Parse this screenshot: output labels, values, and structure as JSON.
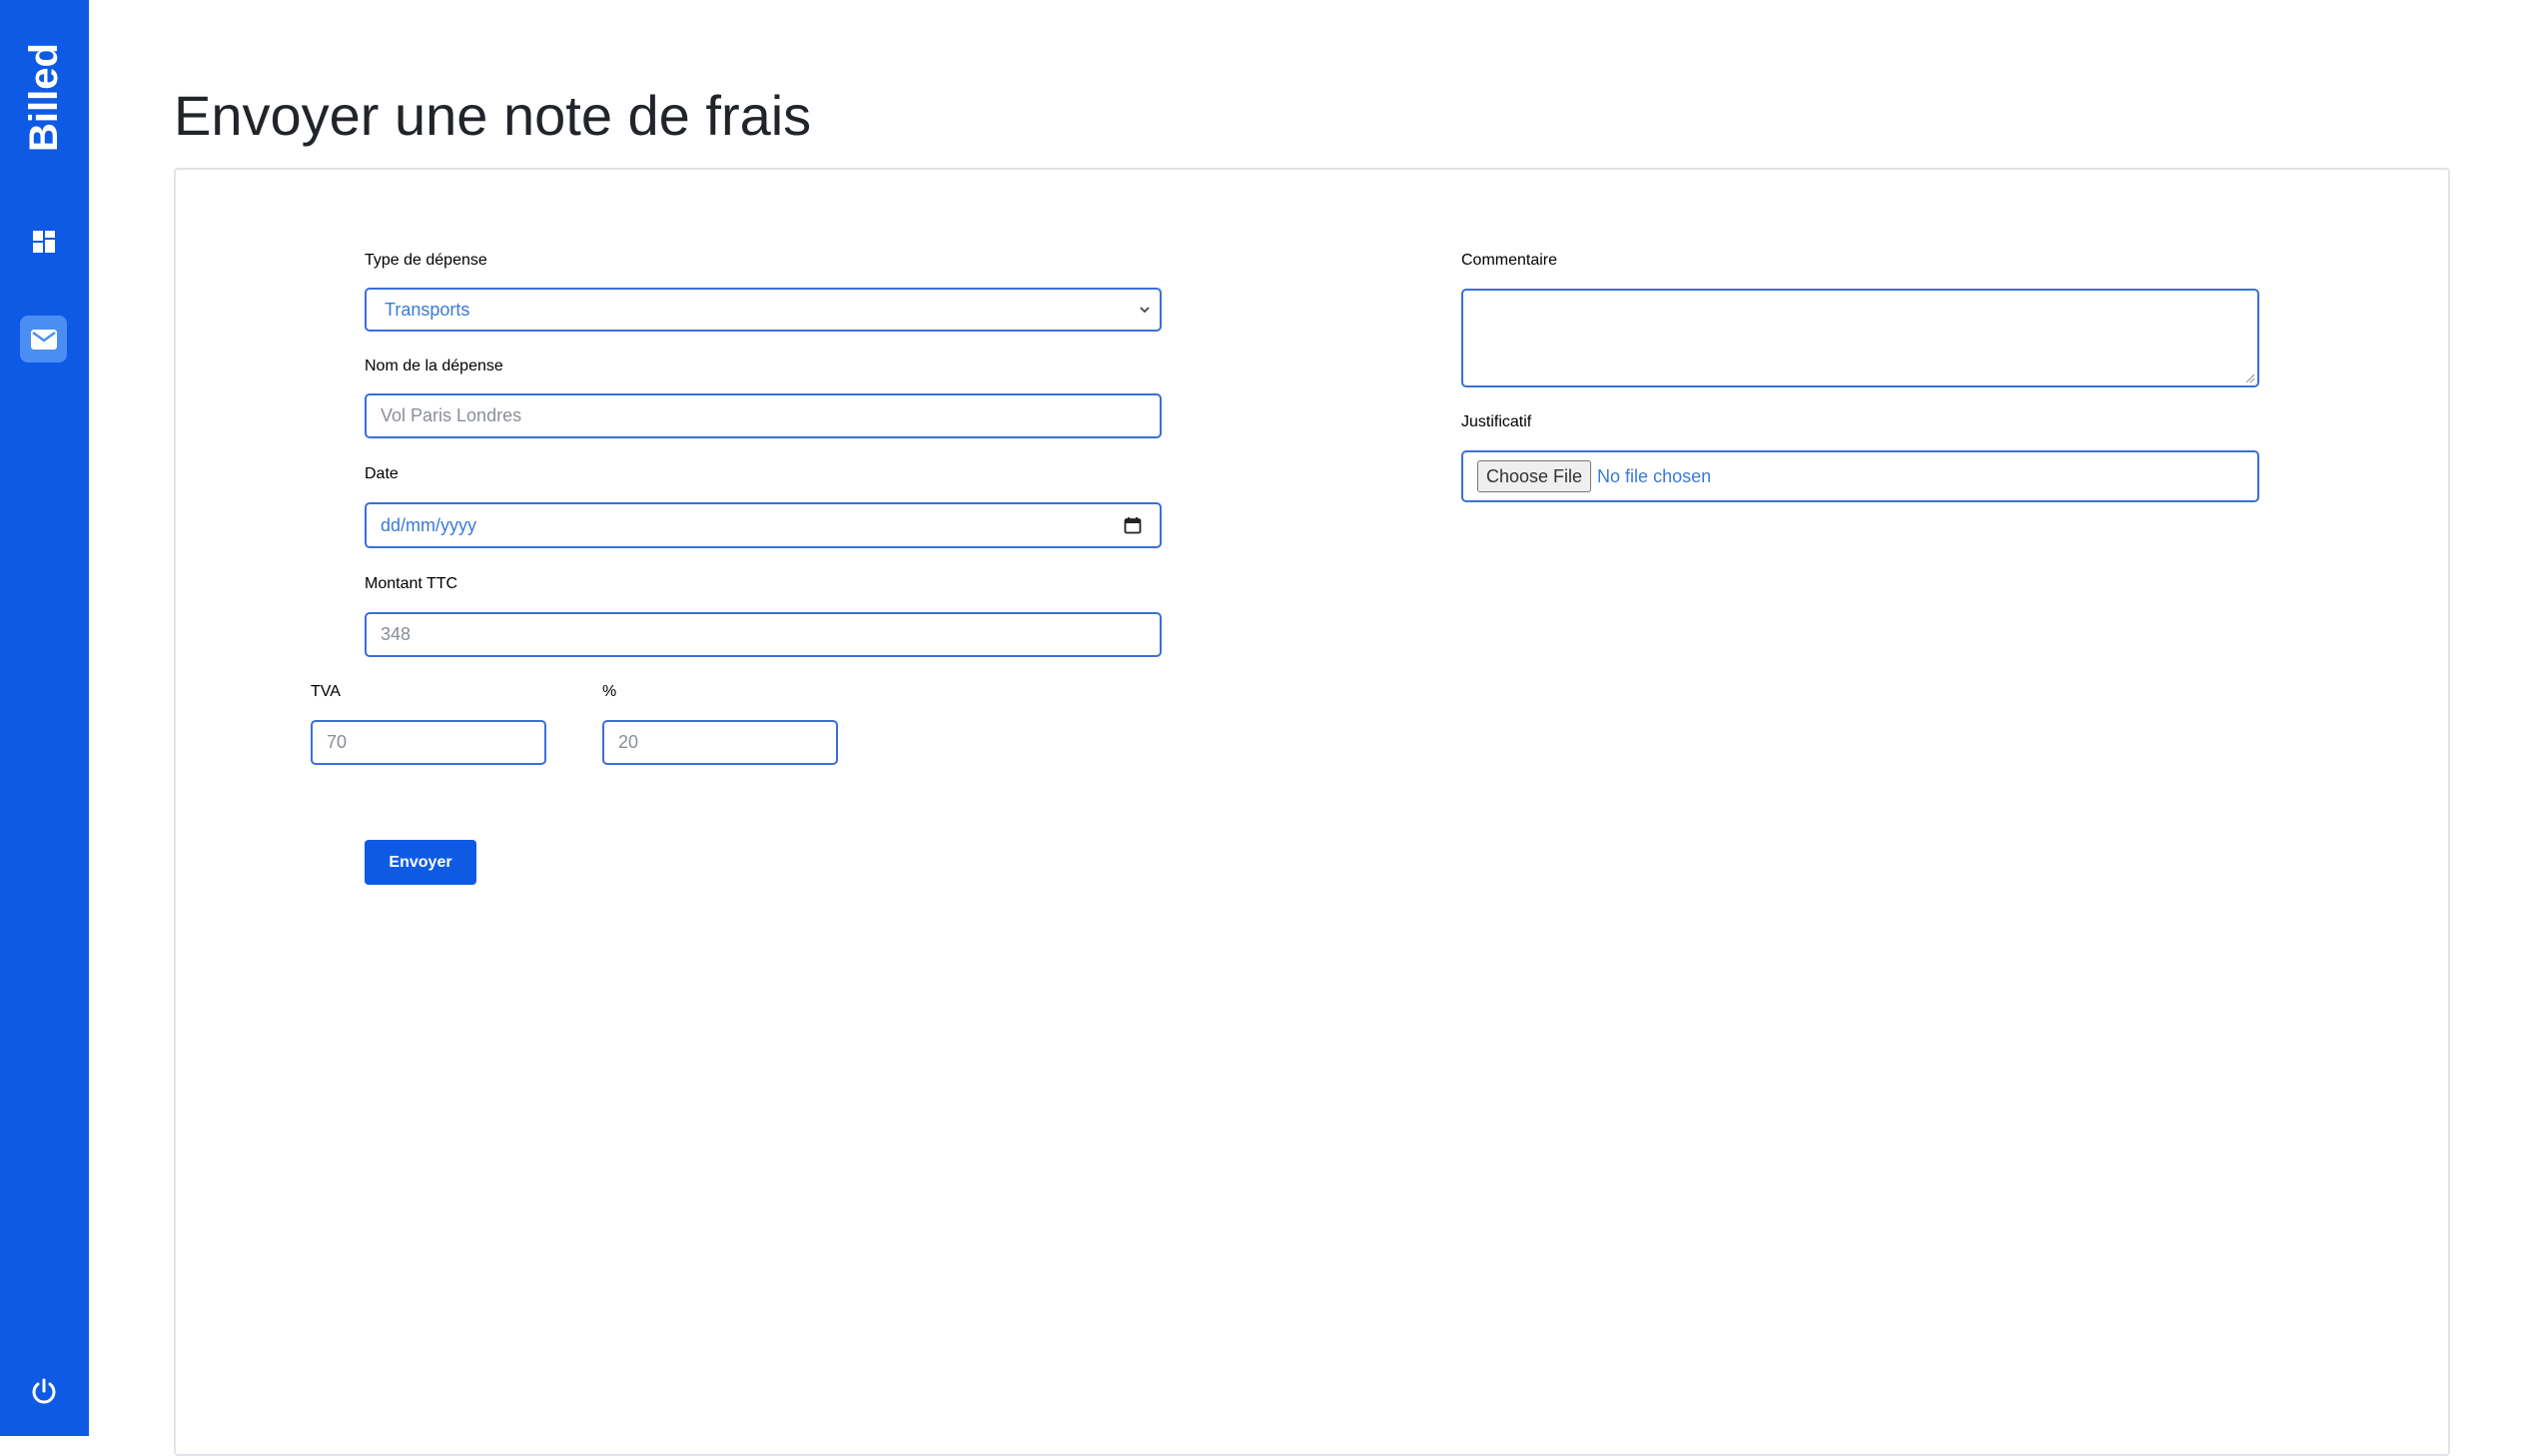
{
  "app": {
    "brand": "Billed"
  },
  "page": {
    "title": "Envoyer une note de frais"
  },
  "form": {
    "type_label": "Type de dépense",
    "type_value": "Transports",
    "name_label": "Nom de la dépense",
    "name_placeholder": "Vol Paris Londres",
    "date_label": "Date",
    "date_placeholder": "dd/mm/yyyy",
    "amount_label": "Montant TTC",
    "amount_placeholder": "348",
    "vat_label": "TVA",
    "vat_placeholder": "70",
    "pct_label": "%",
    "pct_placeholder": "20",
    "comment_label": "Commentaire",
    "file_label": "Justificatif",
    "file_button": "Choose File",
    "file_status": "No file chosen",
    "submit_label": "Envoyer"
  },
  "colors": {
    "sidebar": "#0e5ae5",
    "input_border": "#3a6fd8",
    "active_nav": "#4a8ef3"
  },
  "icons": {
    "bills": "window-icon",
    "mail": "mail-icon",
    "logout": "power-icon"
  }
}
